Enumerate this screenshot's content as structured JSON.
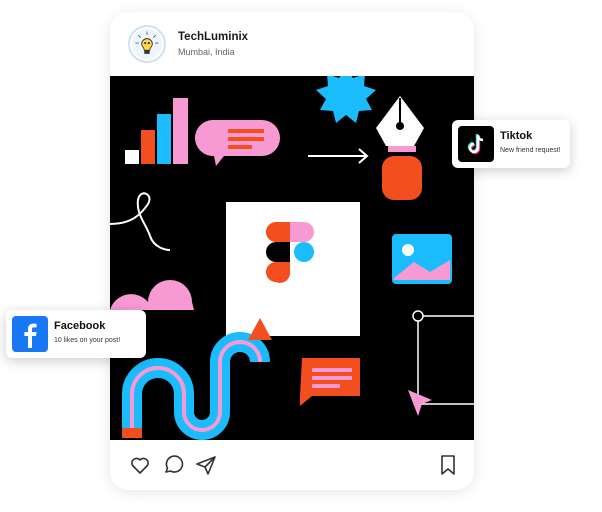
{
  "post": {
    "account_name": "TechLuminix",
    "location": "Mumbai, India",
    "avatar_icon": "lightbulb-logo-icon",
    "image_description_icons": [
      "bar-chart-icon",
      "speech-bubble-icon",
      "arrow-right-icon",
      "pen-nib-icon",
      "figma-logo-icon",
      "image-icon",
      "pencil-icon",
      "cursor-icon"
    ],
    "actions": {
      "like_icon": "heart-icon",
      "comment_icon": "comment-icon",
      "share_icon": "send-icon",
      "save_icon": "bookmark-icon"
    }
  },
  "notifications": {
    "tiktok": {
      "title": "Tiktok",
      "text": "New friend request!",
      "icon": "tiktok-icon"
    },
    "facebook": {
      "title": "Facebook",
      "text": "10 likes on your post!",
      "icon": "facebook-icon"
    }
  },
  "colors": {
    "background": "#000000",
    "pink": "#f79ad3",
    "red": "#f24e1e",
    "blue": "#1abcfe",
    "facebook_blue": "#1877f2"
  }
}
